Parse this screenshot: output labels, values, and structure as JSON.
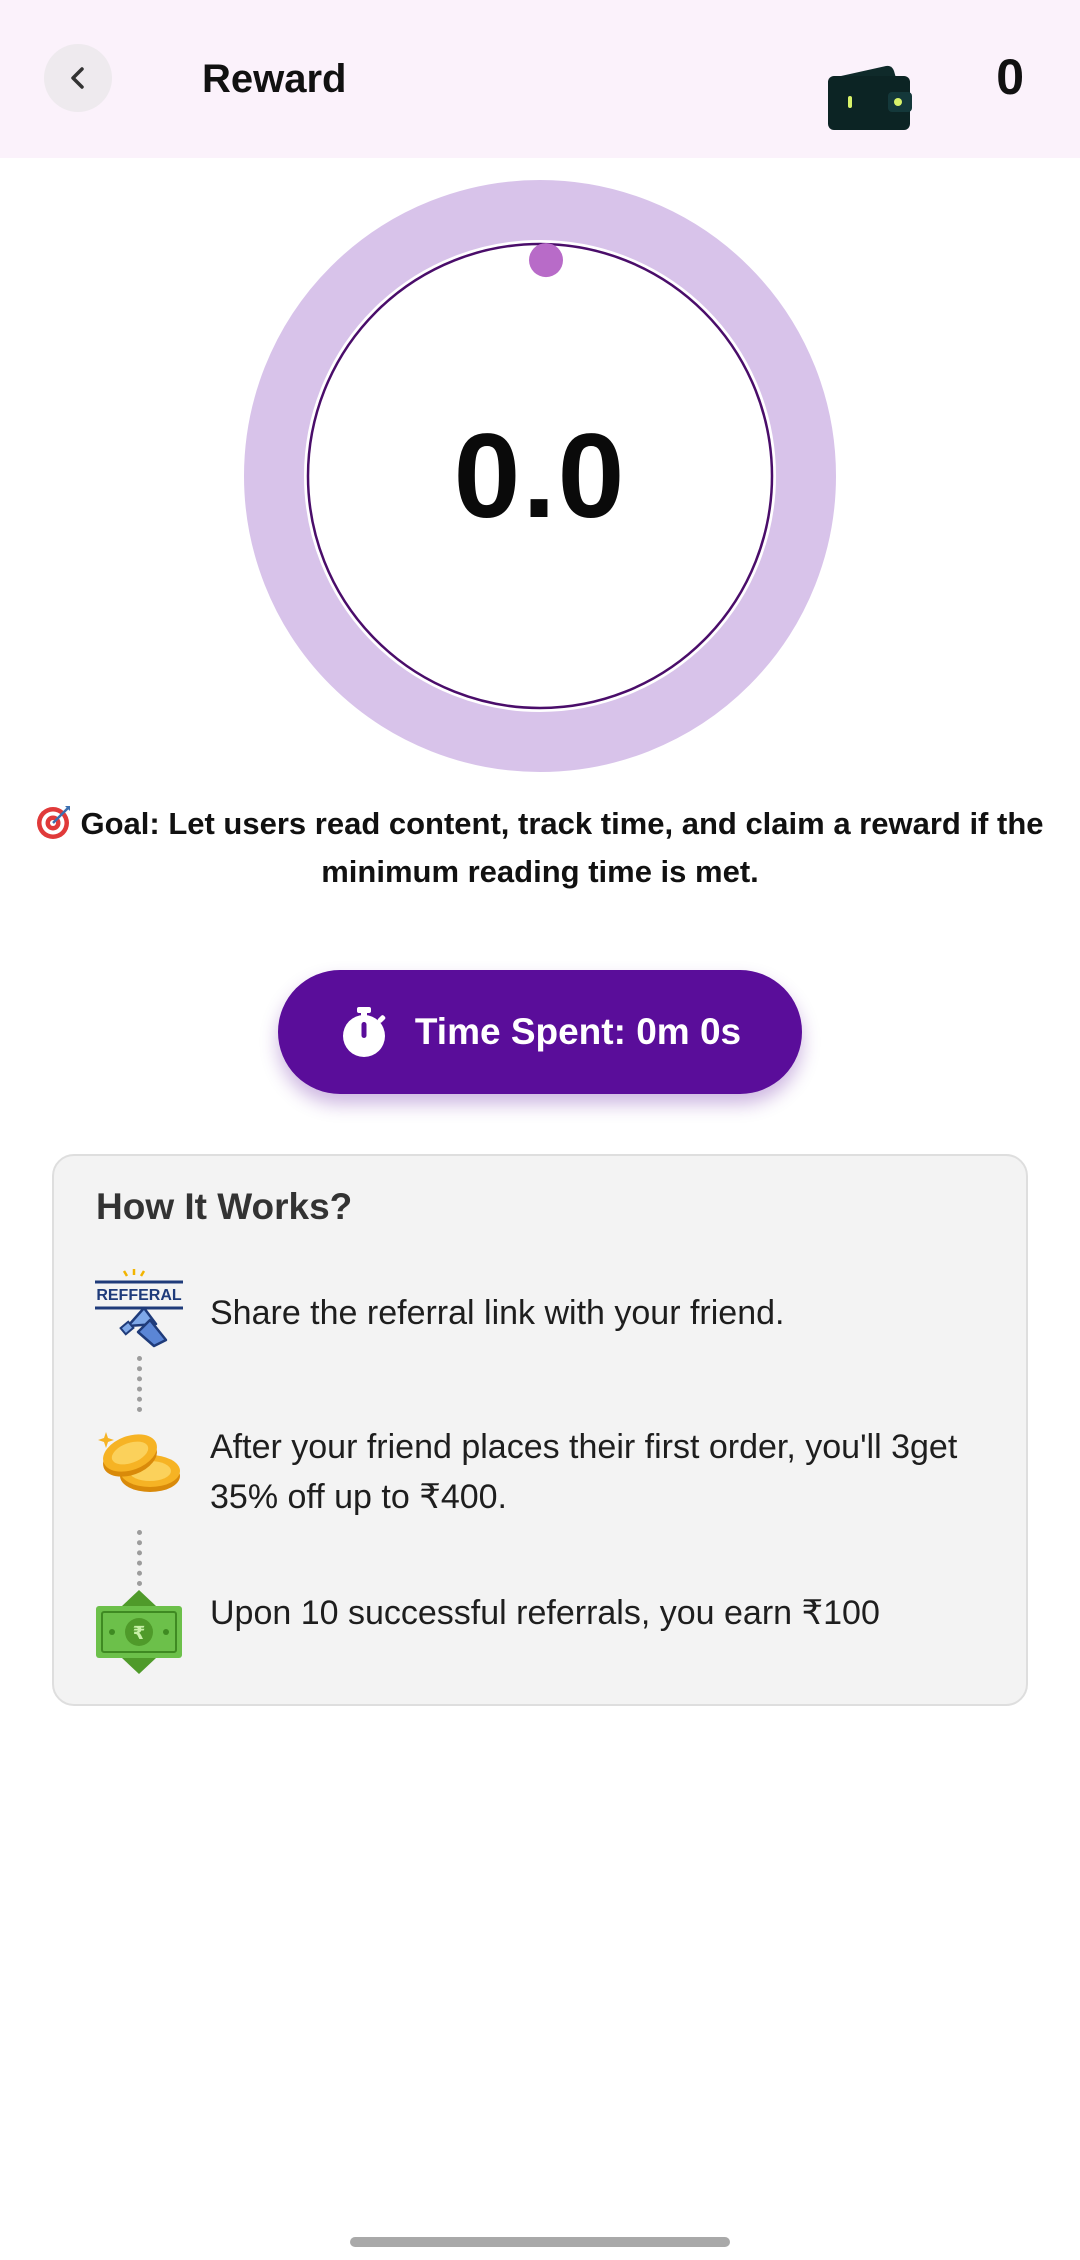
{
  "header": {
    "back_icon": "chevron-left-icon",
    "title": "Reward",
    "wallet_icon": "wallet-icon",
    "wallet_count": "0",
    "background": "#fbf2fb"
  },
  "timer": {
    "value": "0.0",
    "progress": 0,
    "ring_color": "#d8c3ea",
    "inner_border_color": "#4a0d6a",
    "indicator_color": "#b86bc8"
  },
  "goal": {
    "icon": "target-icon",
    "text": "Goal: Let users read content, track time, and claim a reward if the minimum reading time is met."
  },
  "time_button": {
    "icon": "stopwatch-icon",
    "label": "Time Spent: 0m 0s",
    "color": "#5a0d9a"
  },
  "how_it_works": {
    "title": "How It Works?",
    "steps": [
      {
        "icon": "referral-megaphone-icon",
        "icon_text": "REFFERAL",
        "text": "Share the referral link with your friend."
      },
      {
        "icon": "coins-icon",
        "text": "After your friend places their first order, you'll 3get 35% off up to ₹400."
      },
      {
        "icon": "rupee-banknote-icon",
        "text": "Upon 10 successful referrals, you earn ₹100"
      }
    ]
  }
}
